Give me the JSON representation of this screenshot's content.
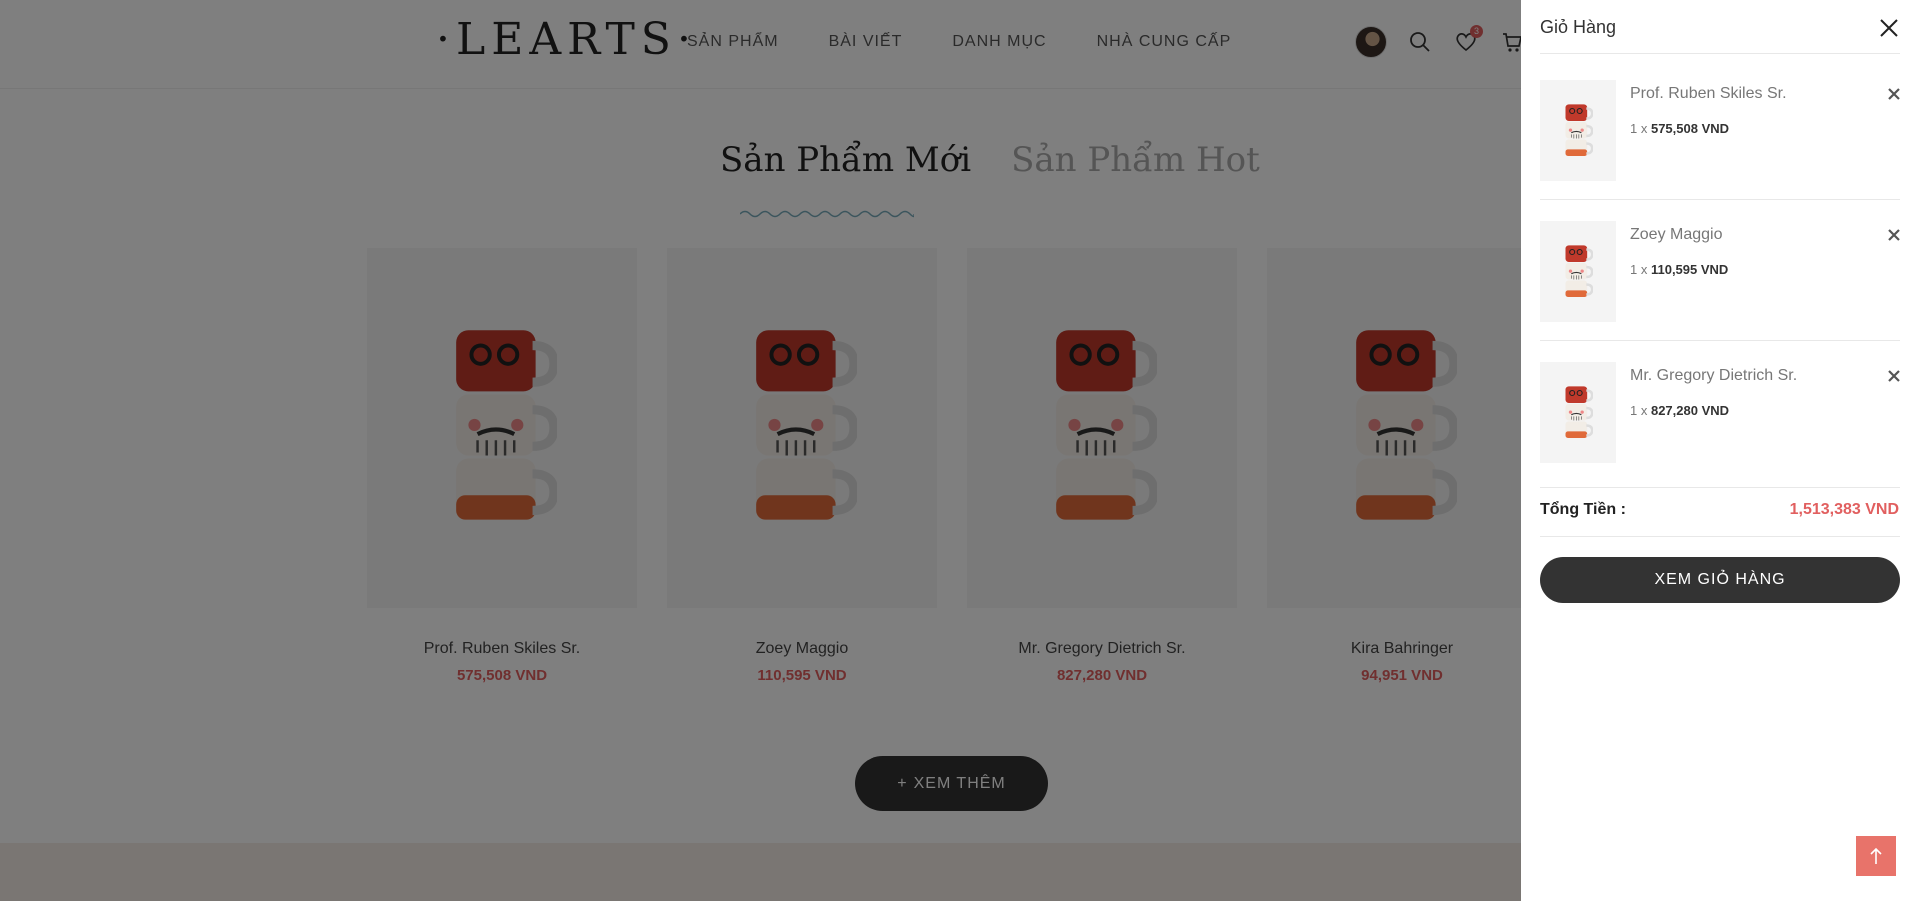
{
  "header": {
    "logo": "·LEARTS·",
    "nav": [
      "SẢN PHẨM",
      "BÀI VIẾT",
      "DANH MỤC",
      "NHÀ CUNG CẤP"
    ],
    "wishlist_count": "3"
  },
  "tabs": {
    "active": "Sản Phẩm Mới",
    "inactive": "Sản Phẩm Hot"
  },
  "products": [
    {
      "name": "Prof. Ruben Skiles Sr.",
      "price": "575,508 VND"
    },
    {
      "name": "Zoey Maggio",
      "price": "110,595 VND"
    },
    {
      "name": "Mr. Gregory Dietrich Sr.",
      "price": "827,280 VND"
    },
    {
      "name": "Kira Bahringer",
      "price": "94,951 VND"
    }
  ],
  "more_button": "XEM THÊM",
  "cart": {
    "title": "Giỏ Hàng",
    "items": [
      {
        "name": "Prof. Ruben Skiles Sr.",
        "qty": "1 x",
        "price": "575,508 VND"
      },
      {
        "name": "Zoey Maggio",
        "qty": "1 x",
        "price": "110,595 VND"
      },
      {
        "name": "Mr. Gregory Dietrich Sr.",
        "qty": "1 x",
        "price": "827,280 VND"
      }
    ],
    "total_label": "Tổng Tiền :",
    "total_value": "1,513,383 VND",
    "view_cart": "XEM GIỎ HÀNG"
  },
  "colors": {
    "accent": "#e15f5f",
    "dark": "#333333"
  }
}
